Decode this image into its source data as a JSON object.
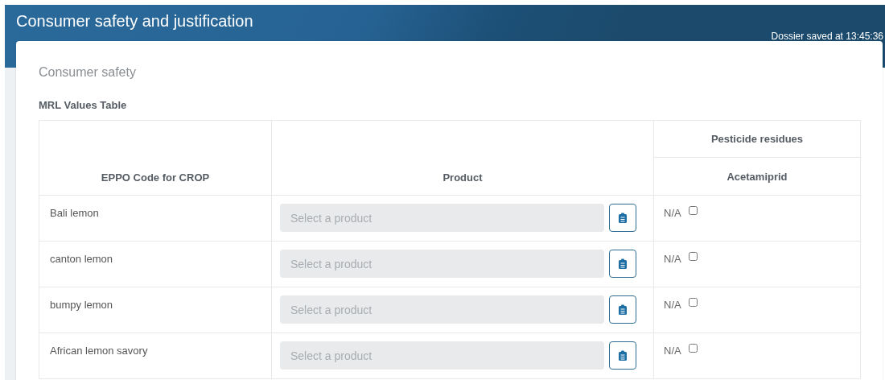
{
  "header": {
    "title": "Consumer safety and justification",
    "save_status": "Dossier saved at 13:45:36"
  },
  "section": {
    "title": "Consumer safety",
    "table_title": "MRL Values Table"
  },
  "table": {
    "columns": {
      "crop": "EPPO Code for CROP",
      "product": "Product",
      "group": "Pesticide residues",
      "residue": "Acetamiprid"
    },
    "rows": [
      {
        "crop": "Bali lemon",
        "product_placeholder": "Select a product",
        "value": "N/A",
        "checked": false
      },
      {
        "crop": "canton lemon",
        "product_placeholder": "Select a product",
        "value": "N/A",
        "checked": false
      },
      {
        "crop": "bumpy lemon",
        "product_placeholder": "Select a product",
        "value": "N/A",
        "checked": false
      },
      {
        "crop": "African lemon savory",
        "product_placeholder": "Select a product",
        "value": "N/A",
        "checked": false
      }
    ]
  }
}
